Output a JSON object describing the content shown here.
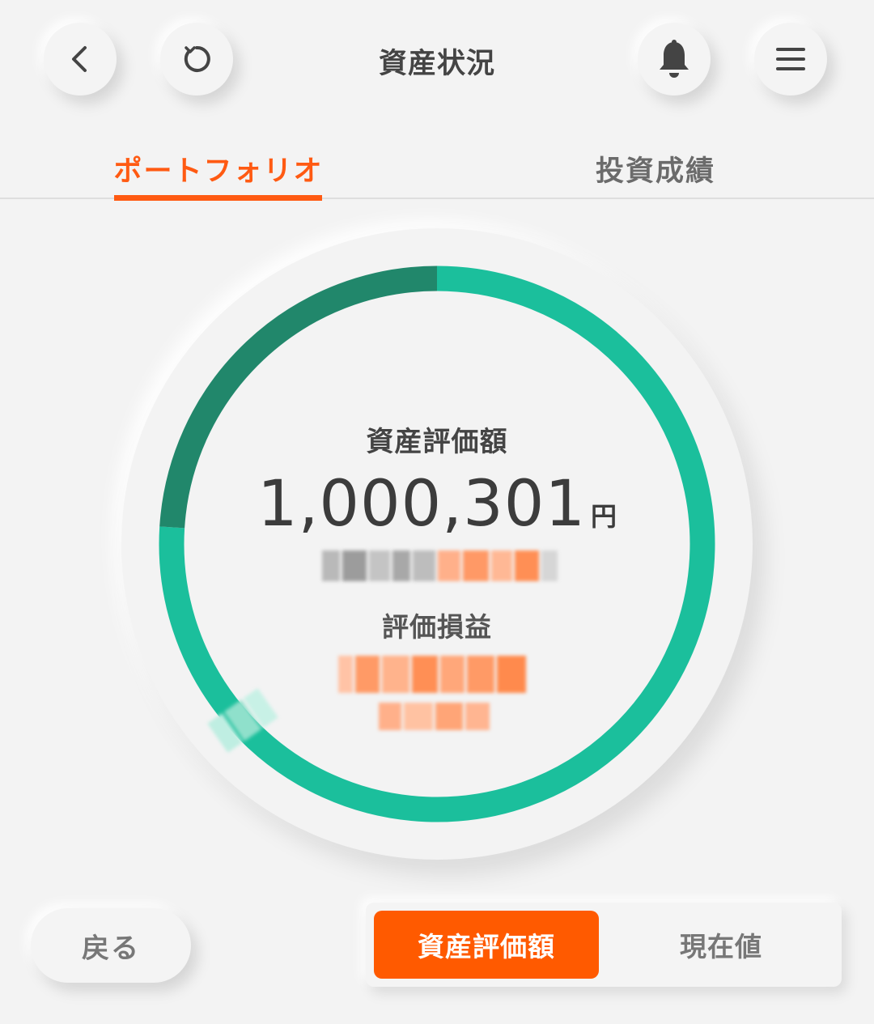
{
  "header": {
    "title": "資産状況",
    "icons": [
      "chevron-left-icon",
      "refresh-icon",
      "bell-icon",
      "hamburger-menu-icon"
    ]
  },
  "tabs": [
    {
      "label": "ポートフォリオ",
      "active": true
    },
    {
      "label": "投資成績",
      "active": false
    }
  ],
  "summary": {
    "label": "資産評価額",
    "value": "1,000,301",
    "unit": "円",
    "pl_label": "評価損益"
  },
  "donut": {
    "segments": [
      {
        "fraction": 0.76,
        "color": "#1bbf9c"
      },
      {
        "fraction": 0.24,
        "color": "#21876b"
      }
    ]
  },
  "colors": {
    "accent": "#ff5a12",
    "teal": "#1bbf9c",
    "dark_teal": "#21876b"
  },
  "bottom": {
    "back_label": "戻る",
    "toggle": [
      {
        "label": "資産評価額",
        "active": true
      },
      {
        "label": "現在値",
        "active": false
      }
    ]
  }
}
